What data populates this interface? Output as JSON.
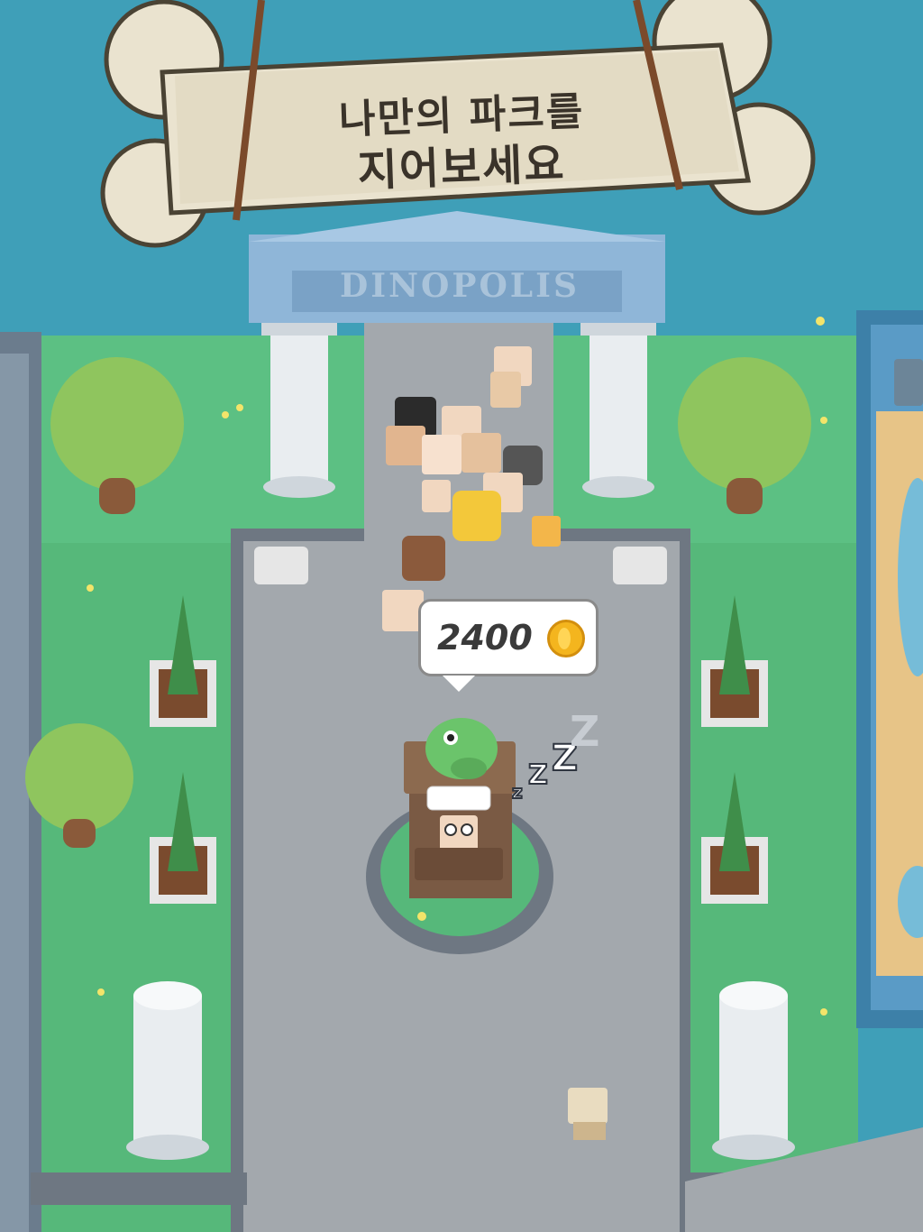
{
  "banner": {
    "line1": "나만의 파크를",
    "line2": "지어보세요"
  },
  "park": {
    "gate_sign": "DINOPOLIS"
  },
  "hud": {
    "coins": "2400",
    "coin_icon": "gold-coin-icon"
  },
  "status": {
    "sleep_glyphs": [
      "z",
      "Z",
      "Z",
      "Z"
    ]
  },
  "colors": {
    "water": "#3f9fb8",
    "grass": "#57b97a",
    "path": "#9ea3a8",
    "coin": "#f4b51e"
  }
}
